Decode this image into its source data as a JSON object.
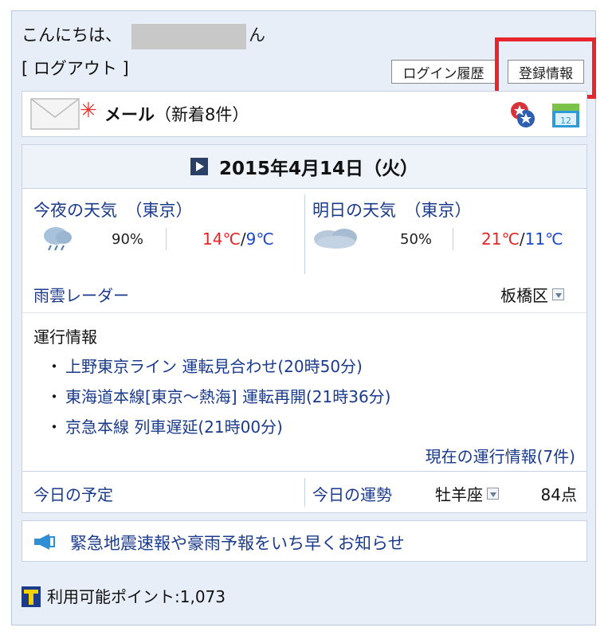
{
  "header": {
    "greeting": "こんにちは、",
    "greeting_suffix": "ん",
    "logout": "[ ログアウト ]",
    "login_history": "ログイン履歴",
    "registration": "登録情報"
  },
  "mail": {
    "label": "メール",
    "count_text": "（新着8件）"
  },
  "weather": {
    "date": "2015年4月14日（火）",
    "tonight": {
      "label": "今夜の天気　（東京）",
      "precip": "90%",
      "high": "14℃",
      "slash": "/",
      "low": "9℃"
    },
    "tomorrow": {
      "label": "明日の天気　（東京）",
      "precip": "50%",
      "high": "21℃",
      "slash": "/",
      "low": "11℃"
    },
    "radar": "雨雲レーダー",
    "ward": "板橋区"
  },
  "train": {
    "title": "運行情報",
    "items": [
      {
        "dot": "・",
        "line": "上野東京ライン 運転見合わせ",
        "time": "(20時50分)"
      },
      {
        "dot": "・",
        "line": "東海道本線[東京〜熱海] 運転再開",
        "time": "(21時36分)"
      },
      {
        "dot": "・",
        "line": "京急本線 列車遅延",
        "time": "(21時00分)"
      }
    ],
    "more": "現在の運行情報(7件)"
  },
  "bottom": {
    "schedule": "今日の予定",
    "fortune": "今日の運勢",
    "sign": "牡羊座",
    "score": "84点"
  },
  "alert": {
    "text": "緊急地震速報や豪雨予報をいち早くお知らせ"
  },
  "points": {
    "text": "利用可能ポイント:1,073"
  },
  "colors": {
    "accent_red": "#e8252d",
    "link_blue": "#1a3a8c",
    "temp_high": "#e52525",
    "temp_low": "#1a48c9"
  }
}
